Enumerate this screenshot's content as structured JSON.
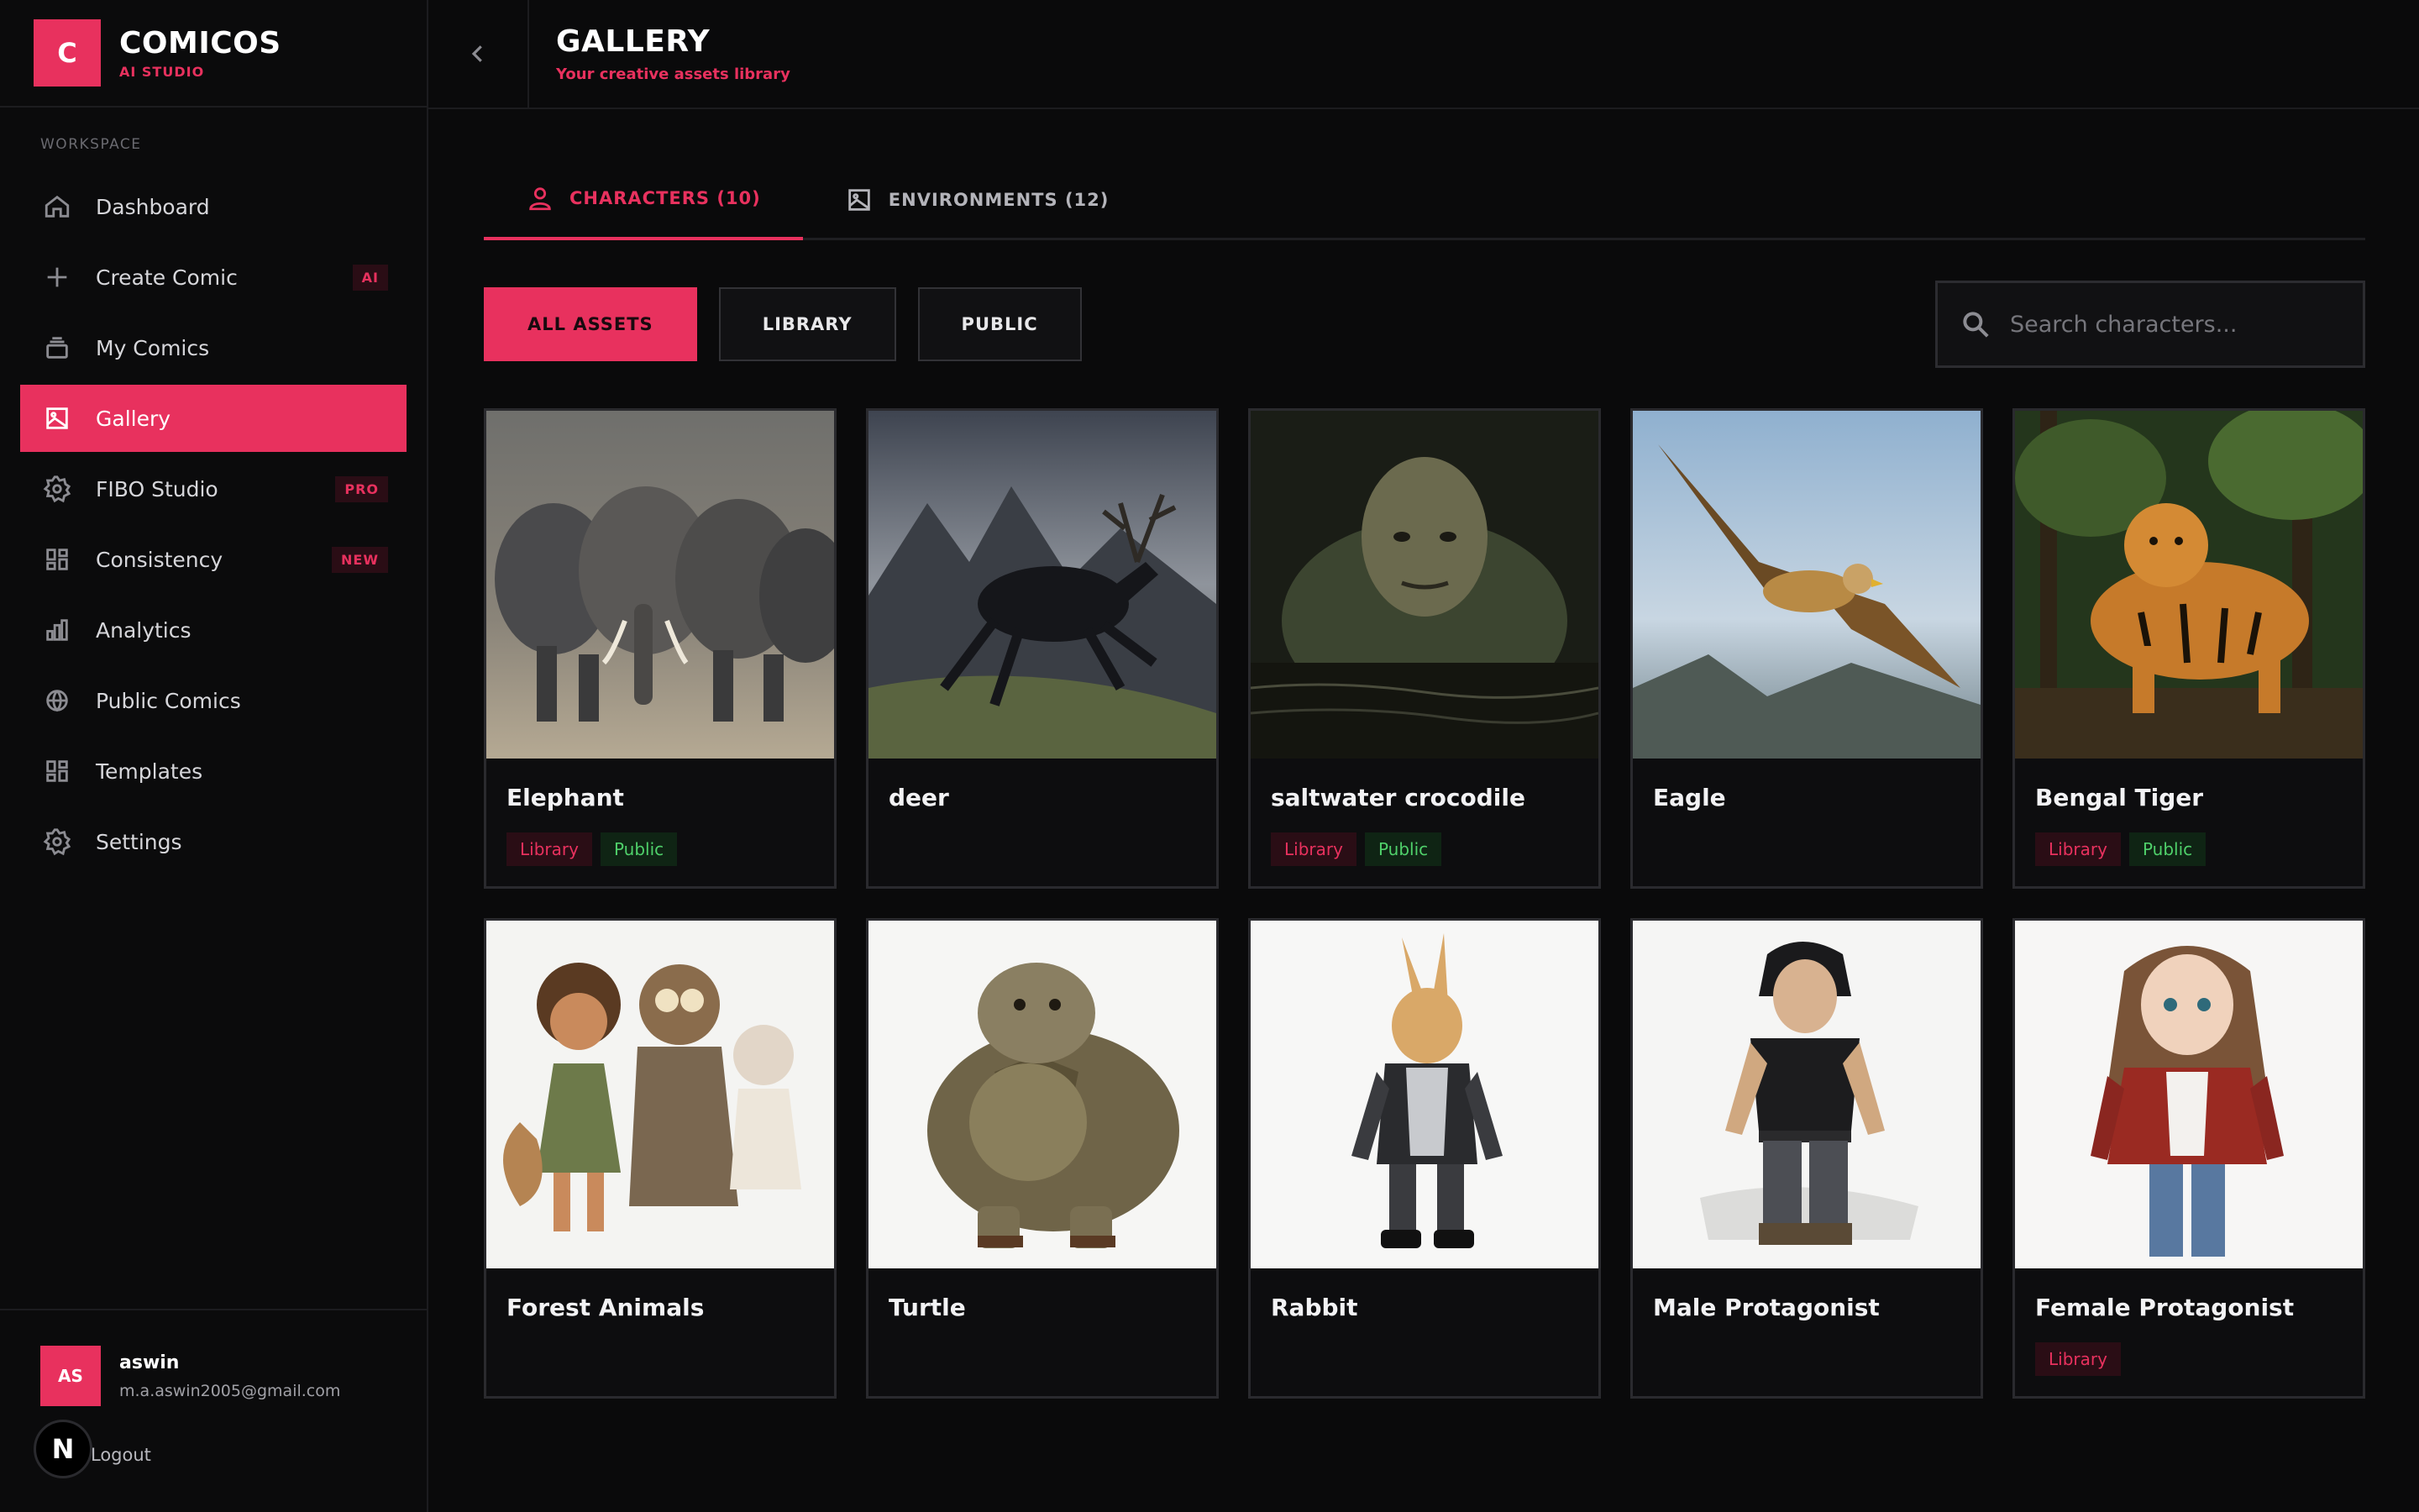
{
  "brand": {
    "logo_letter": "C",
    "name": "COMICOS",
    "subtitle": "AI STUDIO"
  },
  "sidebar": {
    "section_label": "WORKSPACE",
    "items": [
      {
        "label": "Dashboard",
        "icon": "home-icon",
        "badge": ""
      },
      {
        "label": "Create Comic",
        "icon": "plus-icon",
        "badge": "AI"
      },
      {
        "label": "My Comics",
        "icon": "stack-icon",
        "badge": ""
      },
      {
        "label": "Gallery",
        "icon": "image-icon",
        "badge": "",
        "active": true
      },
      {
        "label": "FIBO Studio",
        "icon": "gear-icon",
        "badge": "PRO"
      },
      {
        "label": "Consistency",
        "icon": "grid-icon",
        "badge": "NEW"
      },
      {
        "label": "Analytics",
        "icon": "bar-chart-icon",
        "badge": ""
      },
      {
        "label": "Public Comics",
        "icon": "globe-icon",
        "badge": ""
      },
      {
        "label": "Templates",
        "icon": "grid-icon",
        "badge": ""
      },
      {
        "label": "Settings",
        "icon": "gear-icon",
        "badge": ""
      }
    ]
  },
  "user": {
    "initials": "AS",
    "name": "aswin",
    "email": "m.a.aswin2005@gmail.com",
    "logout_label": "Logout"
  },
  "overlay": {
    "n_badge": "N"
  },
  "header": {
    "title": "GALLERY",
    "subtitle": "Your creative assets library"
  },
  "tabs": [
    {
      "label": "CHARACTERS (10)",
      "icon": "user-icon",
      "active": true
    },
    {
      "label": "ENVIRONMENTS (12)",
      "icon": "image-icon",
      "active": false
    }
  ],
  "filters": [
    {
      "label": "ALL ASSETS",
      "active": true
    },
    {
      "label": "LIBRARY",
      "active": false
    },
    {
      "label": "PUBLIC",
      "active": false
    }
  ],
  "search": {
    "placeholder": "Search characters...",
    "value": ""
  },
  "tag_labels": {
    "library": "Library",
    "public": "Public"
  },
  "colors": {
    "accent": "#e8315e",
    "public_green": "#4fd06a",
    "background": "#0a0a0b"
  },
  "cards": [
    {
      "name": "Elephant",
      "thumb": "elephant-herd",
      "library": true,
      "public": true
    },
    {
      "name": "deer",
      "thumb": "deer",
      "library": false,
      "public": false
    },
    {
      "name": "saltwater crocodile",
      "thumb": "crocodile-man",
      "library": true,
      "public": true
    },
    {
      "name": "Eagle",
      "thumb": "eagle",
      "library": false,
      "public": false
    },
    {
      "name": "Bengal Tiger",
      "thumb": "tiger",
      "library": true,
      "public": true
    },
    {
      "name": "Forest Animals",
      "thumb": "forest-animals",
      "library": false,
      "public": false
    },
    {
      "name": "Turtle",
      "thumb": "turtle",
      "library": false,
      "public": false
    },
    {
      "name": "Rabbit",
      "thumb": "rabbit",
      "library": false,
      "public": false
    },
    {
      "name": "Male Protagonist",
      "thumb": "male-protagonist",
      "library": false,
      "public": false
    },
    {
      "name": "Female Protagonist",
      "thumb": "female-protagonist",
      "library": true,
      "public": false
    }
  ]
}
